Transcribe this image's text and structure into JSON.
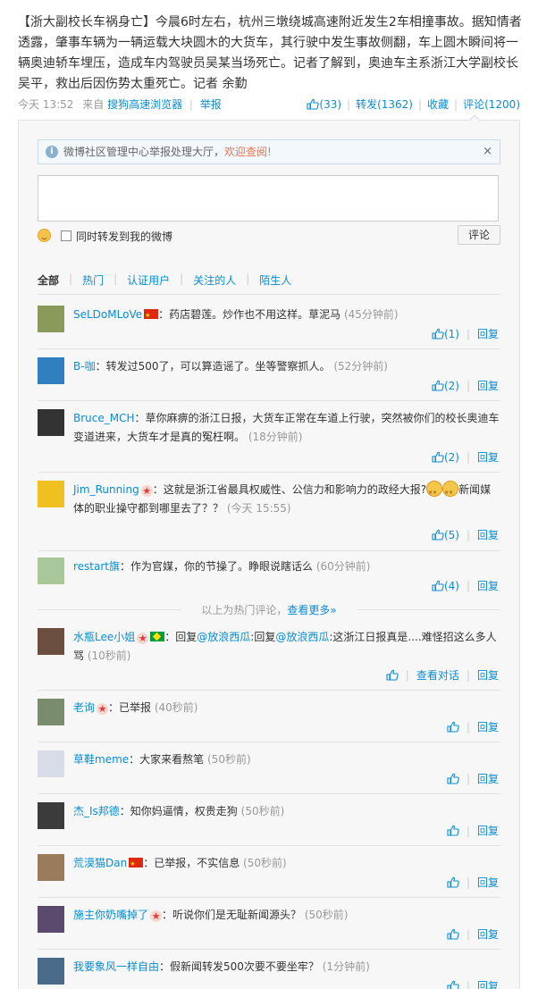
{
  "post": {
    "text": "【浙大副校长车祸身亡】今晨6时左右，杭州三墩绕城高速附近发生2车相撞事故。据知情者透露，肇事车辆为一辆运载大块圆木的大货车，其行驶中发生事故侧翻，车上圆木瞬间将一辆奥迪轿车埋压，造成车内驾驶员吴某当场死亡。记者了解到，奥迪车主系浙江大学副校长吴平，救出后因伤势太重死亡。记者 余勤",
    "time": "今天 13:52",
    "from_prefix": "来自",
    "source": "搜狗高速浏览器",
    "report": "举报",
    "likes": "(33)",
    "repost": "转发(1362)",
    "favorite": "收藏",
    "comment": "评论(1200)"
  },
  "notice": {
    "text": "微博社区管理中心举报处理大厅，",
    "link": "欢迎查阅!",
    "close": "×"
  },
  "composer": {
    "also_repost": "同时转发到我的微博",
    "submit": "评论"
  },
  "filters": [
    "全部",
    "热门",
    "认证用户",
    "关注的人",
    "陌生人"
  ],
  "hot_comments": [
    {
      "user": "SeLDoMLoVe",
      "badge": "flag-cn",
      "text": "：药店碧莲。炒作也不用这样。草泥马",
      "time": "(45分钟前)",
      "likes": "(1)",
      "reply": "回复",
      "avatar": "#8a9a5b"
    },
    {
      "user": "B-咖",
      "badge": "",
      "text": "：转发过500了，可以算造谣了。坐等警察抓人。",
      "time": "(52分钟前)",
      "likes": "(2)",
      "reply": "回复",
      "avatar": "#2f7fc1"
    },
    {
      "user": "Bruce_MCH",
      "badge": "",
      "text": "：草你麻痹的浙江日报，大货车正常在车道上行驶，突然被你们的校长奥迪车变道进来，大货车才是真的冤枉啊。",
      "time": "(18分钟前)",
      "likes": "(2)",
      "reply": "回复",
      "avatar": "#333333"
    },
    {
      "user": "Jim_Running",
      "badge": "vstar",
      "text": "：这就是浙江省最具权威性、公信力和影响力的政经大报?",
      "text2": "新闻媒体的职业操守都到哪里去了？？",
      "time": "(今天 15:55)",
      "likes": "(5)",
      "reply": "回复",
      "avatar": "#f0c020"
    },
    {
      "user": "restart旗",
      "badge": "",
      "text": "：作为官媒，你的节操了。睁眼说瞎话么",
      "time": "(60分钟前)",
      "likes": "(4)",
      "reply": "回复",
      "avatar": "#a8c89a"
    }
  ],
  "hot_footer": {
    "text": "以上为热门评论，",
    "link": "查看更多»"
  },
  "comments": [
    {
      "user": "水瓶Lee小姐",
      "badges": [
        "vstar",
        "flag-br"
      ],
      "prefix": "：回复",
      "at1": "@放浪西瓜",
      "mid": ":回复",
      "at2": "@放浪西瓜",
      "text": ":这浙江日报真是....难怪招这么多人骂",
      "time": "(10秒前)",
      "view": "查看对话",
      "reply": "回复",
      "avatar": "#6b4e3d"
    },
    {
      "user": "老询",
      "badge": "vstar",
      "text": "：已举报",
      "time": "(40秒前)",
      "reply": "回复",
      "avatar": "#7a8c6e"
    },
    {
      "user": "草鞋meme",
      "badge": "",
      "text": "：大家来看熬笔",
      "time": "(50秒前)",
      "reply": "回复",
      "avatar": "#d8dbe8"
    },
    {
      "user": "杰_Is邦德",
      "badge": "",
      "text": "：知你妈逼情，权贵走狗",
      "time": "(50秒前)",
      "reply": "回复",
      "avatar": "#3b3b3b"
    },
    {
      "user": "荒漠猫Dan",
      "badge": "flag-cn",
      "text": "：已举报，不实信息",
      "time": "(50秒前)",
      "reply": "回复",
      "avatar": "#9a7b5c"
    },
    {
      "user": "施主你奶嘴掉了",
      "badge": "vstar",
      "text": "：听说你们是无耻新闻源头？",
      "time": "(50秒前)",
      "reply": "回复",
      "avatar": "#5c4a6e"
    },
    {
      "user": "我要象风一样自由",
      "badge": "",
      "text": "：假新闻转发500次要不要坐牢？",
      "time": "(1分钟前)",
      "reply": "回复",
      "avatar": "#4a6a8a"
    }
  ]
}
